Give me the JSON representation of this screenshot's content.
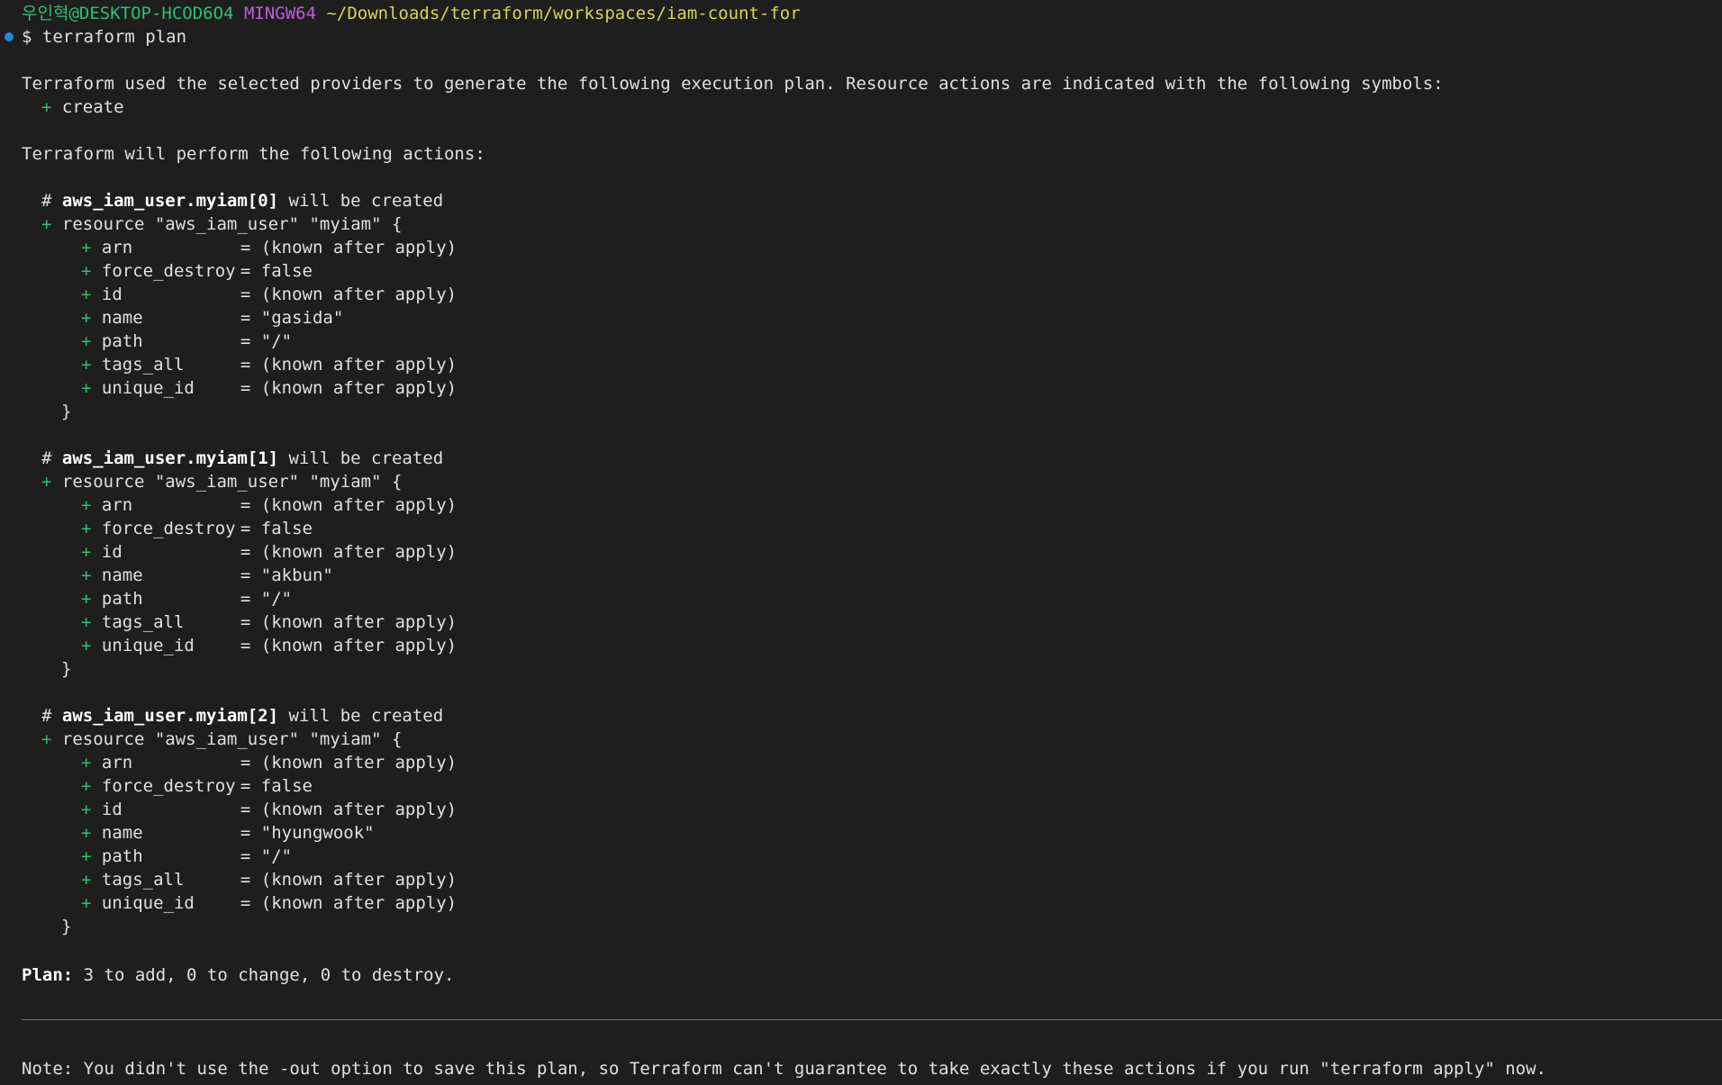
{
  "prompt": {
    "user": "우인혁",
    "host": "@DESKTOP-HCOD6O4",
    "shell": "MINGW64",
    "path": "~/Downloads/terraform/workspaces/iam-count-for",
    "symbol": "$",
    "command": "terraform plan"
  },
  "intro": {
    "line1": "Terraform used the selected providers to generate the following execution plan. Resource actions are indicated with the following symbols:",
    "create_symbol": "+",
    "create_label": "create",
    "line2": "Terraform will perform the following actions:"
  },
  "resources": [
    {
      "address": "aws_iam_user.myiam[0]",
      "suffix": " will be created",
      "header": "resource \"aws_iam_user\" \"myiam\" {",
      "attrs": [
        {
          "name": "arn",
          "value": "= (known after apply)"
        },
        {
          "name": "force_destroy",
          "value": "= false"
        },
        {
          "name": "id",
          "value": "= (known after apply)"
        },
        {
          "name": "name",
          "value": "= \"gasida\""
        },
        {
          "name": "path",
          "value": "= \"/\""
        },
        {
          "name": "tags_all",
          "value": "= (known after apply)"
        },
        {
          "name": "unique_id",
          "value": "= (known after apply)"
        }
      ]
    },
    {
      "address": "aws_iam_user.myiam[1]",
      "suffix": " will be created",
      "header": "resource \"aws_iam_user\" \"myiam\" {",
      "attrs": [
        {
          "name": "arn",
          "value": "= (known after apply)"
        },
        {
          "name": "force_destroy",
          "value": "= false"
        },
        {
          "name": "id",
          "value": "= (known after apply)"
        },
        {
          "name": "name",
          "value": "= \"akbun\""
        },
        {
          "name": "path",
          "value": "= \"/\""
        },
        {
          "name": "tags_all",
          "value": "= (known after apply)"
        },
        {
          "name": "unique_id",
          "value": "= (known after apply)"
        }
      ]
    },
    {
      "address": "aws_iam_user.myiam[2]",
      "suffix": " will be created",
      "header": "resource \"aws_iam_user\" \"myiam\" {",
      "attrs": [
        {
          "name": "arn",
          "value": "= (known after apply)"
        },
        {
          "name": "force_destroy",
          "value": "= false"
        },
        {
          "name": "id",
          "value": "= (known after apply)"
        },
        {
          "name": "name",
          "value": "= \"hyungwook\""
        },
        {
          "name": "path",
          "value": "= \"/\""
        },
        {
          "name": "tags_all",
          "value": "= (known after apply)"
        },
        {
          "name": "unique_id",
          "value": "= (known after apply)"
        }
      ]
    }
  ],
  "closing_brace": "}",
  "plan": {
    "label": "Plan:",
    "summary": " 3 to add, 0 to change, 0 to destroy."
  },
  "note": "Note: You didn't use the -out option to save this plan, so Terraform can't guarantee to take exactly these actions if you run \"terraform apply\" now.",
  "colors": {
    "background": "#1e1e1e",
    "text": "#e0e0e0",
    "green": "#2fbf71",
    "purple": "#c15bd8",
    "yellow": "#d7d35c",
    "cursor_dot": "#1f8ad2"
  }
}
